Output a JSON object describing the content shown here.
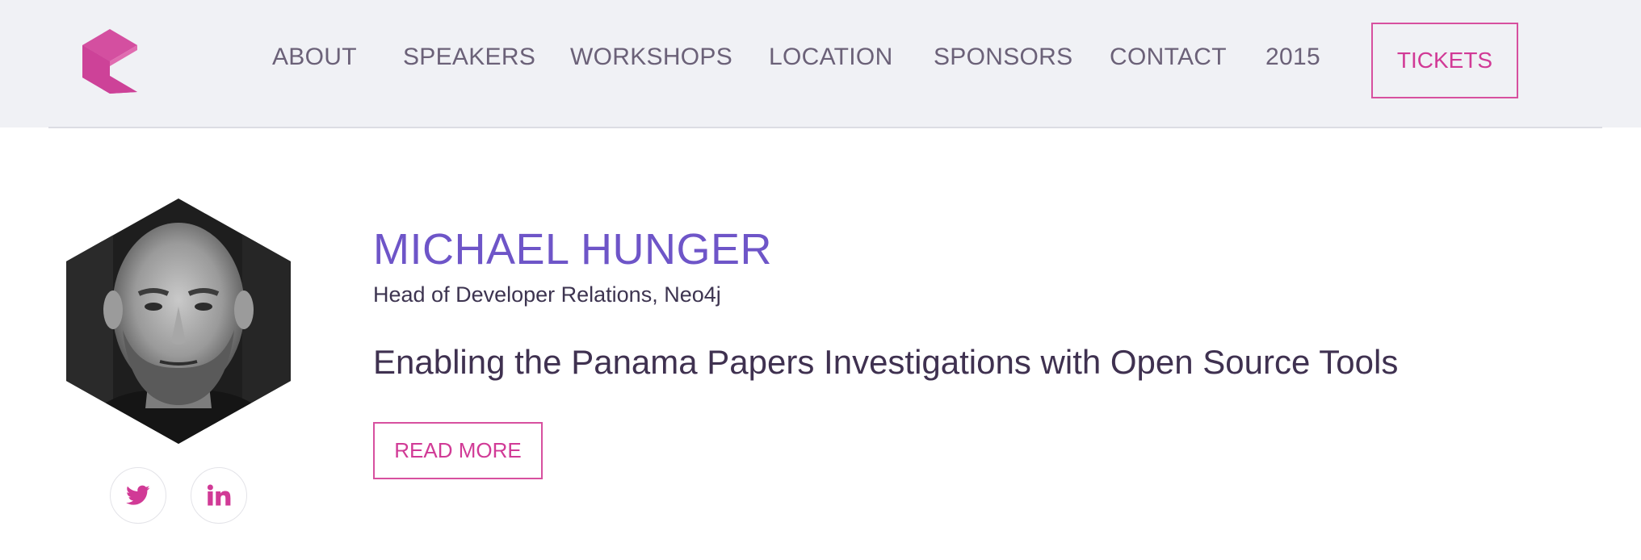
{
  "header": {
    "logo_icon": "hexagon-chevron-logo-icon",
    "nav": [
      {
        "label": "ABOUT"
      },
      {
        "label": "SPEAKERS"
      },
      {
        "label": "WORKSHOPS"
      },
      {
        "label": "LOCATION"
      },
      {
        "label": "SPONSORS"
      },
      {
        "label": "CONTACT"
      },
      {
        "label": "2015"
      }
    ],
    "tickets_label": "TICKETS"
  },
  "speaker": {
    "name": "MICHAEL HUNGER",
    "role": "Head of Developer Relations, Neo4j",
    "talk_title": "Enabling the Panama Papers Investigations with Open Source Tools",
    "read_more_label": "READ MORE",
    "social": [
      {
        "icon": "twitter-icon"
      },
      {
        "icon": "linkedin-icon"
      }
    ]
  },
  "colors": {
    "accent_pink": "#d13a96",
    "name_purple": "#6e55c8",
    "header_bg": "#f0f1f5",
    "nav_text": "#6b6178",
    "title_text": "#3f3150"
  }
}
